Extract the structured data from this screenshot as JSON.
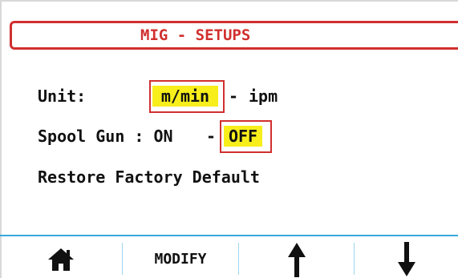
{
  "header": {
    "title": "MIG - SETUPS"
  },
  "settings": {
    "unit": {
      "label": "Unit:",
      "selected": "m/min",
      "separator": "-",
      "alternate": "ipm"
    },
    "spool_gun": {
      "label": "Spool Gun : ON",
      "separator": "-",
      "selected": "OFF"
    },
    "restore": {
      "label": "Restore Factory Default"
    }
  },
  "footer": {
    "home_icon": "home-icon",
    "modify_label": "MODIFY",
    "up_icon": "arrow-up-icon",
    "down_icon": "arrow-down-icon"
  },
  "colors": {
    "accent_red": "#d0302f",
    "highlight_yellow": "#f7ee1c",
    "divider_blue": "#39a9dc"
  }
}
